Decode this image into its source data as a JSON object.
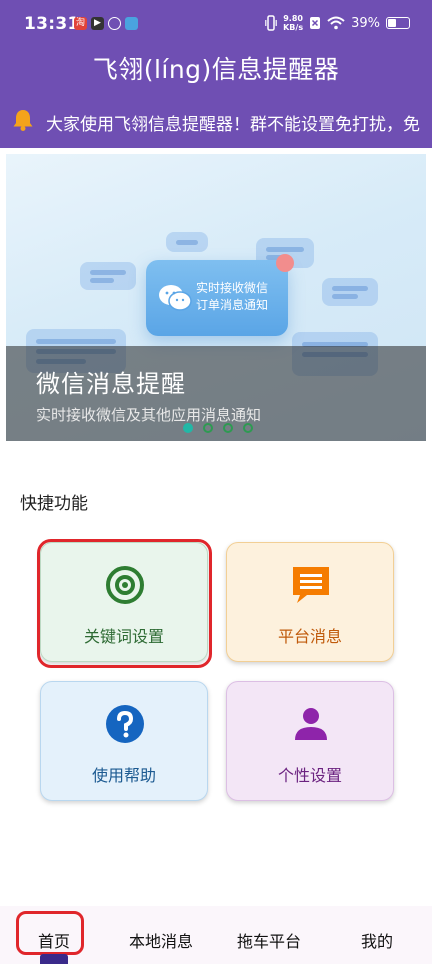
{
  "status_bar": {
    "time": "13:31",
    "net_speed_value": "9.80",
    "net_speed_unit": "KB/s",
    "battery": "39%"
  },
  "app": {
    "title": "飞翎(líng)信息提醒器"
  },
  "notice": {
    "icon": "bell-icon",
    "text": "大家使用飞翎信息提醒器！群不能设置免打扰，免"
  },
  "banner": {
    "bubble_text_line1": "实时接收微信",
    "bubble_text_line2": "订单消息通知",
    "title": "微信消息提醒",
    "subtitle": "实时接收微信及其他应用消息通知",
    "slides": 4,
    "active_slide": 1
  },
  "quick": {
    "section_title": "快捷功能",
    "items": [
      {
        "label": "关键词设置",
        "icon": "target-icon",
        "color": "#2e7d32"
      },
      {
        "label": "平台消息",
        "icon": "message-icon",
        "color": "#f57c00"
      },
      {
        "label": "使用帮助",
        "icon": "help-icon",
        "color": "#1565c0"
      },
      {
        "label": "个性设置",
        "icon": "person-icon",
        "color": "#8e24aa"
      }
    ]
  },
  "tabs": [
    {
      "label": "首页",
      "active": true
    },
    {
      "label": "本地消息",
      "active": false
    },
    {
      "label": "拖车平台",
      "active": false
    },
    {
      "label": "我的",
      "active": false
    }
  ],
  "colors": {
    "header": "#6f4fb3",
    "highlight": "#e0262b"
  }
}
